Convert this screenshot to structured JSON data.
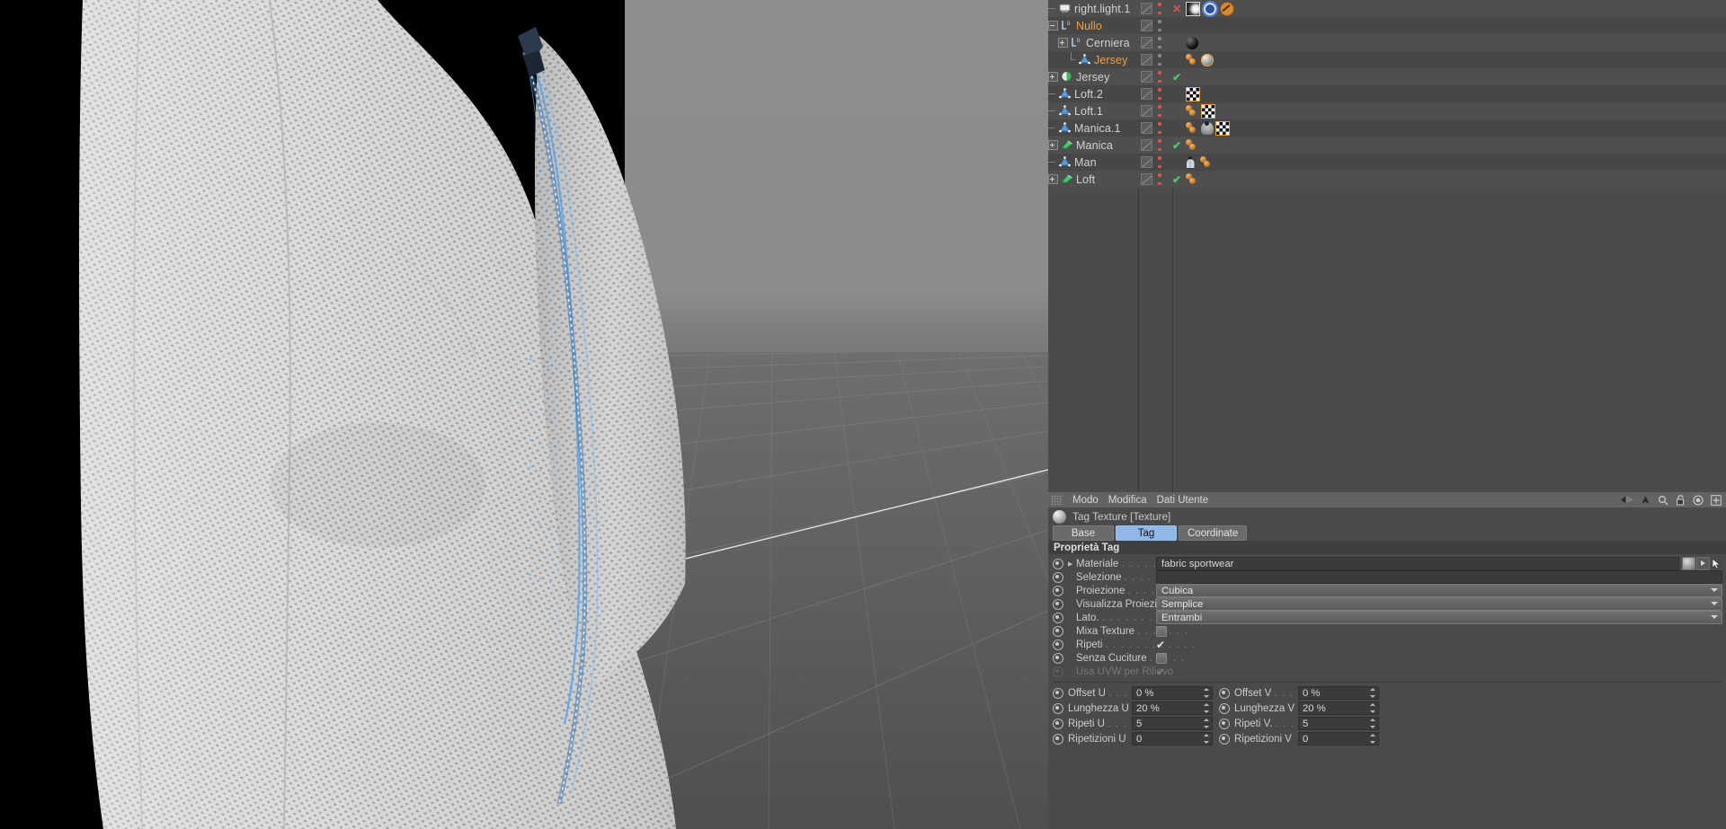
{
  "app": {
    "name": "Cinema 4D",
    "locale": "it"
  },
  "viewport": {
    "name": "perspective-viewport",
    "description": "3D render of a sportswear jersey shoulder and sleeve with mesh fabric texture and a blue zipper seam",
    "background_top": "#8d8d8d",
    "background_bottom": "#555555",
    "black_backdrop": "#000000",
    "accent_zipper": "#4a90d9"
  },
  "object_manager": {
    "name": "Oggetti",
    "rows": [
      {
        "label": "right.light.1",
        "icon": "light-icon",
        "indent": 0,
        "tree": "dash",
        "expander": "none",
        "highlight": false,
        "state": "x",
        "tags": [
          "light-tag",
          "target-tag",
          "ban-tag"
        ]
      },
      {
        "label": "Nullo",
        "icon": "null-icon",
        "indent": 0,
        "tree": "none",
        "expander": "minus",
        "highlight": true,
        "state": "none",
        "tags": []
      },
      {
        "label": "Cerniera",
        "icon": "null-icon",
        "indent": 1,
        "tree": "none",
        "expander": "plus",
        "highlight": false,
        "state": "none",
        "tags": [
          "material-black-tag"
        ]
      },
      {
        "label": "Jersey",
        "icon": "spline-icon",
        "indent": 2,
        "tree": "corner",
        "expander": "none",
        "highlight": true,
        "state": "none",
        "tags": [
          "two-dots-tag",
          "material-selected-tag"
        ]
      },
      {
        "label": "Jersey",
        "icon": "sweep-icon",
        "indent": 0,
        "tree": "none",
        "expander": "plus",
        "highlight": false,
        "state": "check",
        "tags": []
      },
      {
        "label": "Loft.2",
        "icon": "spline-icon",
        "indent": 0,
        "tree": "dash",
        "expander": "none",
        "highlight": false,
        "state": "none",
        "tags": [
          "checker-tag"
        ]
      },
      {
        "label": "Loft.1",
        "icon": "spline-icon",
        "indent": 0,
        "tree": "dash",
        "expander": "none",
        "highlight": false,
        "state": "none",
        "tags": [
          "two-dots-tag",
          "checker-tag"
        ]
      },
      {
        "label": "Manica.1",
        "icon": "spline-icon",
        "indent": 0,
        "tree": "dash",
        "expander": "none",
        "highlight": false,
        "state": "none",
        "tags": [
          "two-dots-tag",
          "vertexmap-tag",
          "checker-tag"
        ]
      },
      {
        "label": "Manica",
        "icon": "poly-icon",
        "indent": 0,
        "tree": "none",
        "expander": "plus",
        "highlight": false,
        "state": "check",
        "tags": [
          "two-dots-tag"
        ]
      },
      {
        "label": "Man",
        "icon": "spline-icon",
        "indent": 0,
        "tree": "dash",
        "expander": "none",
        "highlight": false,
        "state": "none",
        "tags": [
          "cloth-tag",
          "two-dots-tag"
        ]
      },
      {
        "label": "Loft",
        "icon": "poly-icon",
        "indent": 0,
        "tree": "none",
        "expander": "plus",
        "highlight": false,
        "state": "check",
        "tags": [
          "two-dots-tag"
        ]
      }
    ]
  },
  "attribute_manager": {
    "menus": [
      "Modo",
      "Modifica",
      "Dati Utente"
    ],
    "tools": [
      "back-arrow-icon",
      "up-arrow-icon",
      "search-icon",
      "lock-icon",
      "target-icon",
      "add-panel-icon"
    ],
    "header_title": "Tag Texture [Texture]",
    "tabs": [
      {
        "label": "Base",
        "active": false
      },
      {
        "label": "Tag",
        "active": true
      },
      {
        "label": "Coordinate",
        "active": false
      }
    ],
    "section_title": "Proprietà Tag",
    "properties": [
      {
        "label": "Materiale",
        "dots": ". . . . . . . .",
        "type": "field",
        "value": "fabric sportwear",
        "has_arrow": true,
        "buttons": true
      },
      {
        "label": "Selezione",
        "dots": ". . . . . . . . .",
        "type": "field",
        "value": ""
      },
      {
        "label": "Proiezione",
        "dots": ". . . . . . . . .",
        "type": "combo",
        "value": "Cubica"
      },
      {
        "label": "Visualizza Proiezione",
        "dots": "",
        "type": "combo",
        "value": "Semplice"
      },
      {
        "label": "Lato.",
        "dots": ". . . . . . . . . . . . .",
        "type": "combo",
        "value": "Entrambi"
      },
      {
        "label": "Mixa Texture",
        "dots": ". . . . . . .",
        "type": "checkbox",
        "checked": false
      },
      {
        "label": "Ripeti",
        "dots": ". . . . . . . . . . . .",
        "type": "checkmark",
        "checked": true
      },
      {
        "label": "Senza Cuciture",
        "dots": ". . . . .",
        "type": "checkbox",
        "checked": false
      },
      {
        "label": "Usa UVW per Rilievo",
        "dots": "",
        "type": "checkmark",
        "checked": true,
        "disabled": true
      }
    ],
    "numeric_grid": [
      {
        "left_label": "Offset U",
        "left_dots": ". . . .",
        "left_value": "0 %",
        "right_label": "Offset V",
        "right_dots": ". . . .",
        "right_value": "0 %"
      },
      {
        "left_label": "Lunghezza U",
        "left_dots": "",
        "left_value": "20 %",
        "right_label": "Lunghezza V",
        "right_dots": "",
        "right_value": "20 %"
      },
      {
        "left_label": "Ripeti U",
        "left_dots": ". . . .",
        "left_value": "5",
        "right_label": "Ripeti V.",
        "right_dots": ". . . .",
        "right_value": "5"
      },
      {
        "left_label": "Ripetizioni U",
        "left_dots": "",
        "left_value": "0",
        "right_label": "Ripetizioni V",
        "right_dots": "",
        "right_value": "0"
      }
    ]
  },
  "colors": {
    "panel_bg": "#4a4a4a",
    "row_alt": "#4f4f4f",
    "highlight_text": "#e8a33d",
    "tab_active": "#8fb8e8",
    "check_green": "#49c76a",
    "x_red": "#e2534b"
  }
}
